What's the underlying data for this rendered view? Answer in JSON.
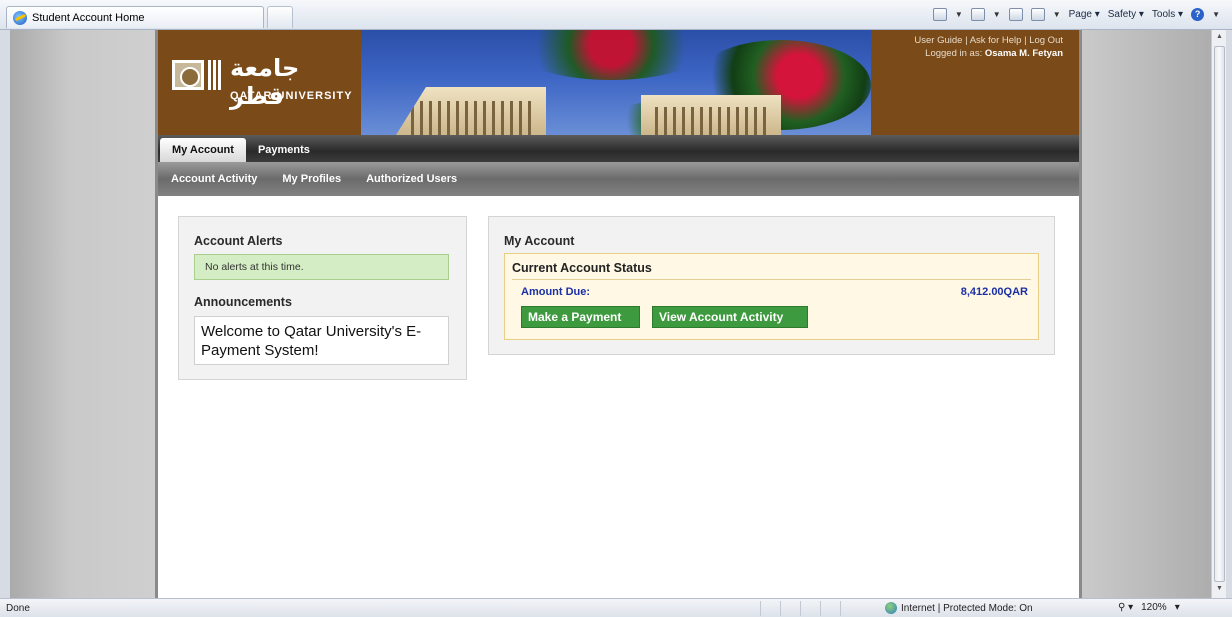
{
  "browser": {
    "tab_title": "Student Account Home",
    "command_bar": {
      "page_label": "Page ▾",
      "safety_label": "Safety ▾",
      "tools_label": "Tools ▾"
    }
  },
  "header": {
    "logo_ar": "جامعة قطر",
    "logo_en": "QATAR UNIVERSITY",
    "links": {
      "user_guide": "User Guide",
      "ask_help": "Ask for Help",
      "log_out": "Log Out",
      "separator": " | "
    },
    "logged_in_prefix": "Logged in as:",
    "logged_in_name": "Osama M. Fetyan"
  },
  "nav": {
    "tabs": [
      {
        "label": "My Account",
        "active": true
      },
      {
        "label": "Payments",
        "active": false
      }
    ],
    "subtabs": [
      "Account Activity",
      "My Profiles",
      "Authorized Users"
    ]
  },
  "left_panel": {
    "alerts_title": "Account Alerts",
    "alerts_message": "No alerts at this time.",
    "announcements_title": "Announcements",
    "announcement_text": "Welcome to Qatar University's E-Payment System!"
  },
  "right_panel": {
    "title": "My Account",
    "status_title": "Current Account Status",
    "amount_due_label": "Amount Due:",
    "amount_due_value": "8,412.00QAR",
    "make_payment_label": "Make a Payment",
    "view_activity_label": "View Account Activity"
  },
  "statusbar": {
    "done": "Done",
    "zone": "Internet | Protected Mode: On",
    "zoom": "120%"
  },
  "colors": {
    "header_brown": "#7a4a18",
    "alert_green": "#d4edc4",
    "button_green": "#3e9a3e",
    "amount_blue": "#1b2fa6",
    "status_bg": "#fff8e4"
  }
}
